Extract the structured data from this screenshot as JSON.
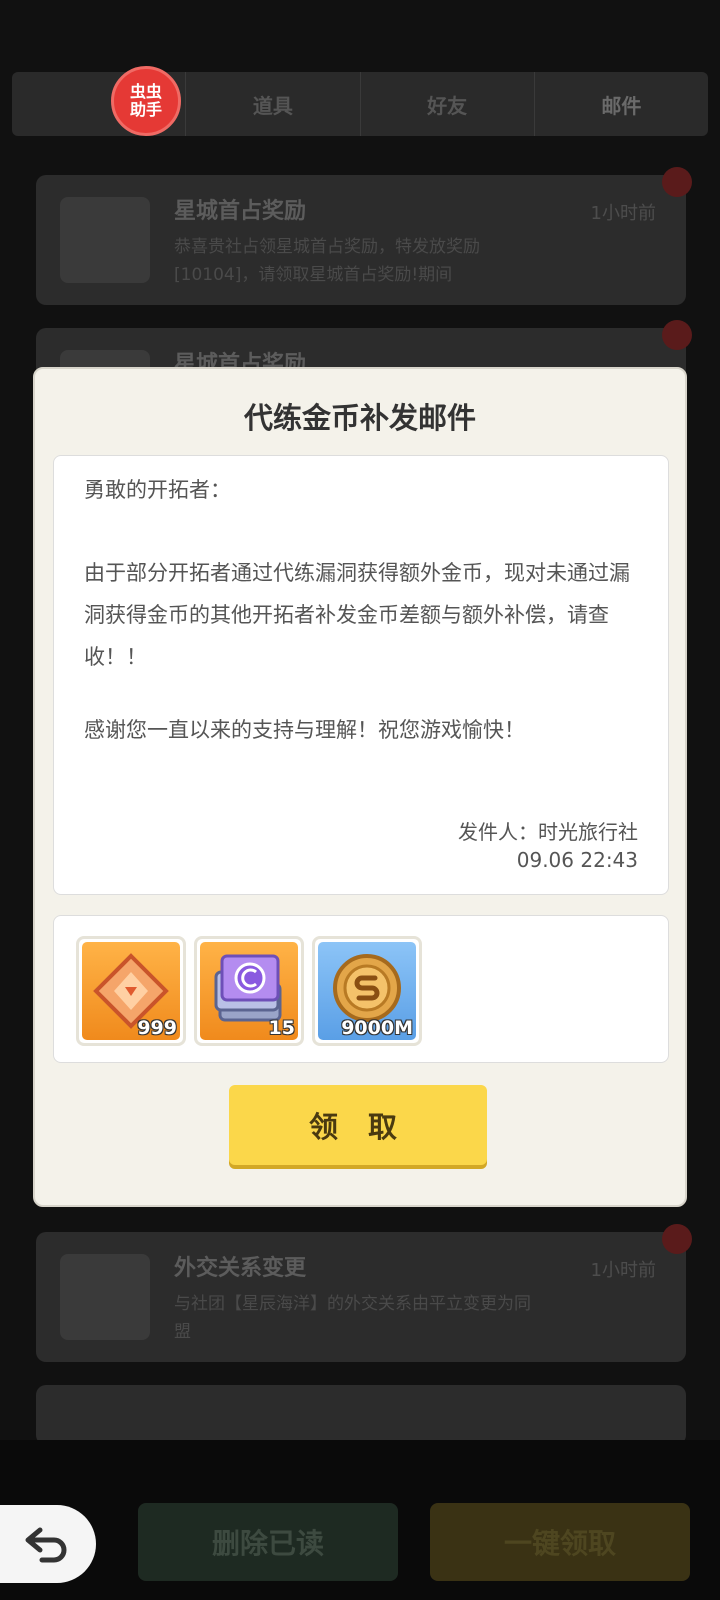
{
  "helper_badge": {
    "line1": "虫虫",
    "line2": "助手"
  },
  "tabs": [
    {
      "label": ""
    },
    {
      "label": "道具"
    },
    {
      "label": "好友"
    },
    {
      "label": "邮件"
    }
  ],
  "mail_list": [
    {
      "title": "星城首占奖励",
      "date": "1小时前",
      "preview": "恭喜贵社占领星城首占奖励，特发放奖励[10104]，请领取星城首占奖励!期间"
    },
    {
      "title": "星城首占奖励",
      "date": "",
      "preview": ""
    },
    {
      "title": "外交关系变更",
      "date": "1小时前",
      "preview": "与社团【星辰海洋】的外交关系由平立变更为同盟"
    },
    {
      "title": "",
      "date": "",
      "preview": ""
    }
  ],
  "modal": {
    "title": "代练金币补发邮件",
    "greeting": "勇敢的开拓者：",
    "body": "由于部分开拓者通过代练漏洞获得额外金币，现对未通过漏洞获得金币的其他开拓者补发金币差额与额外补偿，请查收！！",
    "thanks": "感谢您一直以来的支持与理解！祝您游戏愉快！",
    "sender": "发件人：时光旅行社",
    "time": "09.06 22:43",
    "rewards": [
      {
        "icon": "orange-crystal-icon",
        "count": "999"
      },
      {
        "icon": "ticket-stack-icon",
        "count": "15"
      },
      {
        "icon": "gold-coin-icon",
        "count": "9000M"
      }
    ],
    "claim_label": "领 取"
  },
  "bottom": {
    "delete_read_label": "删除已读",
    "claim_all_label": "一键领取"
  },
  "colors": {
    "claim_button": "#fbd74a",
    "modal_bg": "#f4f2ea",
    "helper_badge": "#e53935"
  }
}
